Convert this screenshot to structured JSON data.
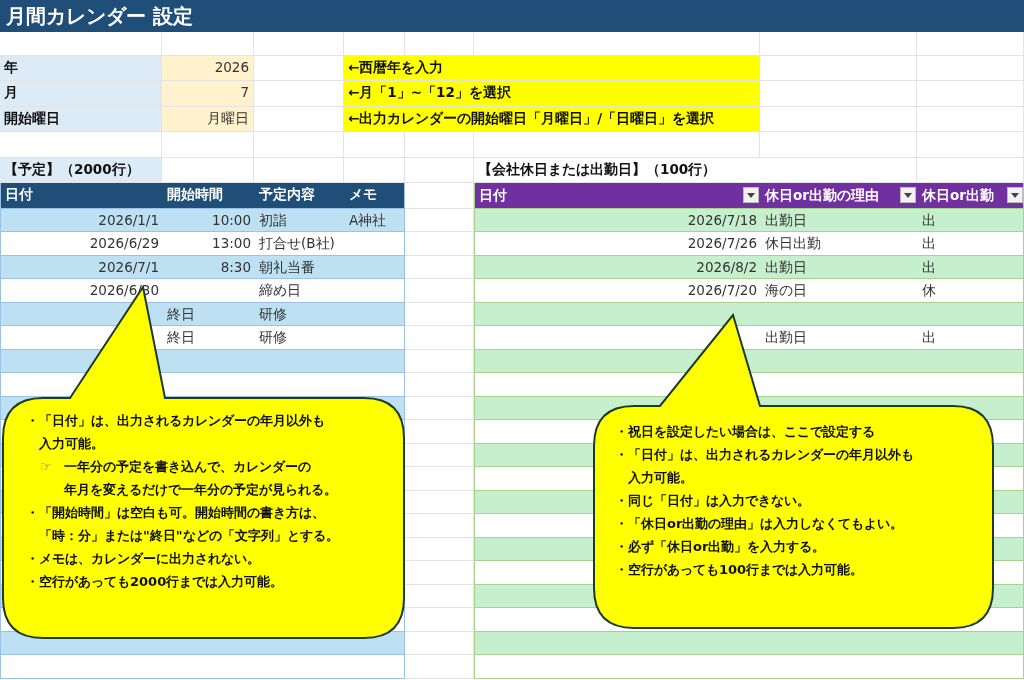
{
  "title": "月間カレンダー 設定",
  "settings": [
    {
      "label": "年",
      "value": "2026",
      "note": "←西暦年を入力"
    },
    {
      "label": "月",
      "value": "7",
      "note": "←月「1」~「12」を選択"
    },
    {
      "label": "開始曜日",
      "value": "月曜日",
      "note": "←出力カレンダーの開始曜日「月曜日」/「日曜日」を選択"
    }
  ],
  "schedule": {
    "heading": "【予定】（2000行）",
    "columns": [
      "日付",
      "開始時間",
      "予定内容",
      "メモ"
    ],
    "rows": [
      {
        "date": "2026/1/1",
        "start": {
          "kind": "time",
          "text": "10:00"
        },
        "content": "初詣",
        "memo": "A神社"
      },
      {
        "date": "2026/6/29",
        "start": {
          "kind": "time",
          "text": "13:00"
        },
        "content": "打合せ(B社)"
      },
      {
        "date": "2026/7/1",
        "start": {
          "kind": "time",
          "text": "8:30"
        },
        "content": "朝礼当番"
      },
      {
        "date": "2026/6/30",
        "content": "締め日"
      },
      {
        "start": {
          "kind": "text",
          "text": "終日"
        },
        "content": "研修"
      },
      {
        "start": {
          "kind": "text",
          "text": "終日"
        },
        "content": "研修"
      }
    ]
  },
  "holidays": {
    "heading": "【会社休日または出勤日】（100行）",
    "columns": [
      {
        "label": "日付",
        "filter": true
      },
      {
        "label": "休日or出勤の理由",
        "filter": true
      },
      {
        "label": "休日or出勤",
        "filter": true
      }
    ],
    "rows": [
      {
        "date": "2026/7/18",
        "reason": "出勤日",
        "type": "出"
      },
      {
        "date": "2026/7/26",
        "reason": "休日出勤",
        "type": "出"
      },
      {
        "date": "2026/8/2",
        "reason": "出勤日",
        "type": "出"
      },
      {
        "date": "2026/7/20",
        "reason": "海の日",
        "type": "休"
      },
      {},
      {
        "reason": "出勤日",
        "type": "出"
      }
    ]
  },
  "callouts": [
    {
      "items": [
        {
          "kind": "bullet",
          "lines": [
            "・「日付」は、出力されるカレンダーの年月以外も",
            "入力可能。"
          ]
        },
        {
          "kind": "hand",
          "mark": "☞",
          "lines": [
            "一年分の予定を書き込んで、カレンダーの",
            "年月を変えるだけで一年分の予定が見られる。"
          ]
        },
        {
          "kind": "bullet",
          "lines": [
            "・「開始時間」は空白も可。開始時間の書き方は、",
            "「時：分」または\"終日\"などの「文字列」とする。"
          ]
        },
        {
          "kind": "bullet",
          "lines": [
            "・メモは、カレンダーに出力されない。"
          ]
        },
        {
          "kind": "bullet",
          "lines": [
            "・空行があっても2000行までは入力可能。"
          ]
        }
      ]
    },
    {
      "items": [
        {
          "kind": "bullet",
          "lines": [
            "・祝日を設定したい場合は、ここで設定する"
          ]
        },
        {
          "kind": "bullet",
          "lines": [
            "・「日付」は、出力されるカレンダーの年月以外も",
            "入力可能。"
          ]
        },
        {
          "kind": "bullet",
          "lines": [
            "・同じ「日付」は入力できない。"
          ]
        },
        {
          "kind": "bullet",
          "lines": [
            "・「休日or出勤の理由」は入力しなくてもよい。"
          ]
        },
        {
          "kind": "bullet",
          "lines": [
            "・必ず「休日or出勤」を入力する。"
          ]
        },
        {
          "kind": "bullet",
          "lines": [
            "・空行があっても100行までは入力可能。"
          ]
        }
      ]
    }
  ]
}
